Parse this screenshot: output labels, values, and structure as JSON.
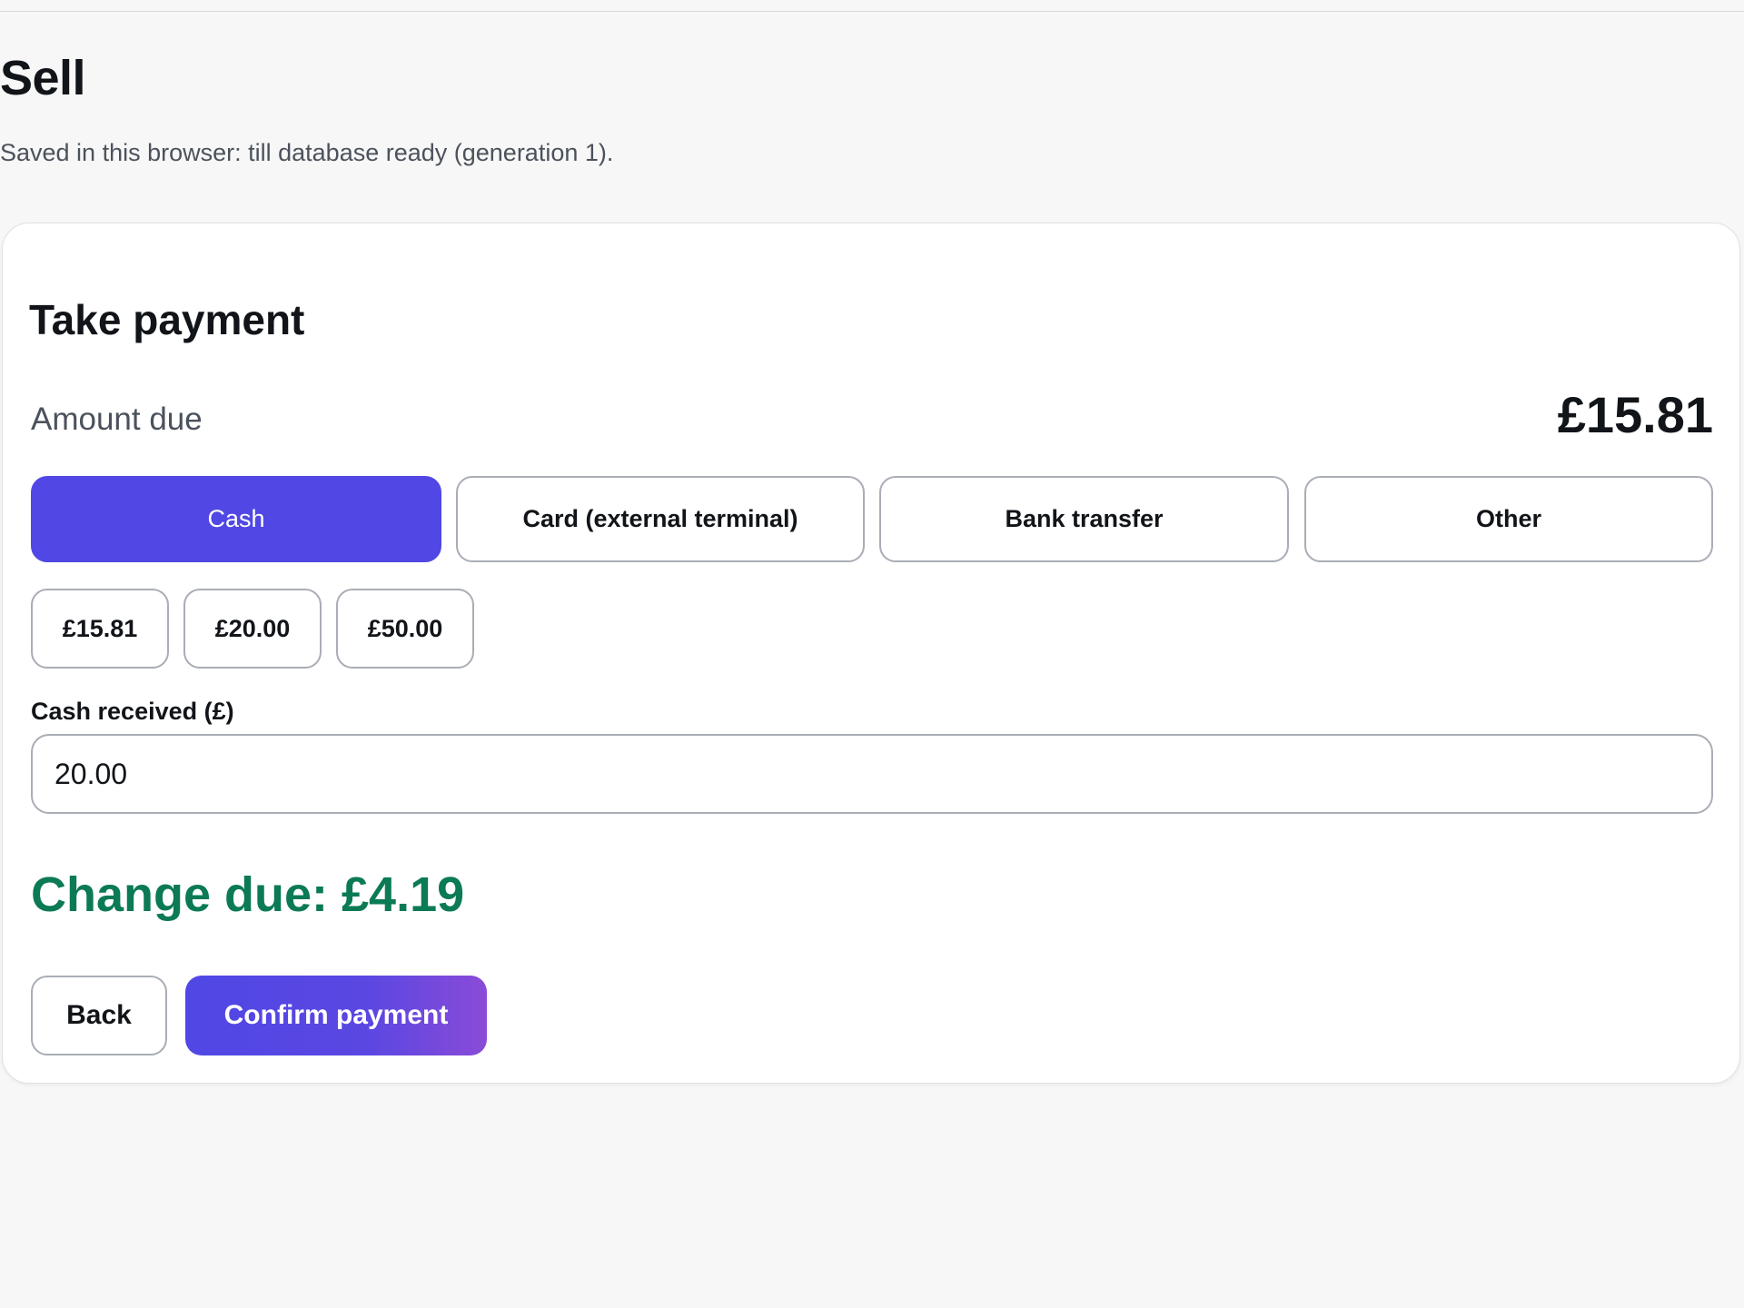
{
  "page": {
    "title": "Sell",
    "save_status": "Saved in this browser: till database ready (generation 1)."
  },
  "payment": {
    "title": "Take payment",
    "amount_due_label": "Amount due",
    "amount_due_value": "£15.81",
    "methods": [
      {
        "label": "Cash",
        "selected": true
      },
      {
        "label": "Card (external terminal)",
        "selected": false
      },
      {
        "label": "Bank transfer",
        "selected": false
      },
      {
        "label": "Other",
        "selected": false
      }
    ],
    "quick_amounts": [
      "£15.81",
      "£20.00",
      "£50.00"
    ],
    "cash_received_label": "Cash received (£)",
    "cash_received_value": "20.00",
    "change_due": "Change due: £4.19",
    "back_label": "Back",
    "confirm_label": "Confirm payment"
  },
  "colors": {
    "accent": "#5047e5",
    "change_due": "#0b7a55",
    "background": "#f7f7f7"
  }
}
